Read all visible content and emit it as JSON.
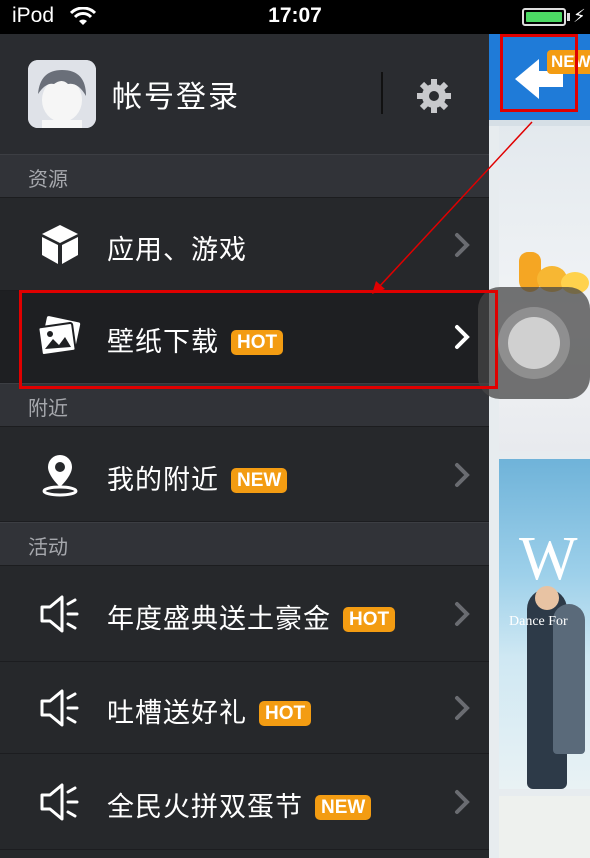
{
  "status_bar": {
    "carrier": "iPod",
    "time": "17:07",
    "battery_level": 1.0
  },
  "drawer": {
    "profile": {
      "login_label": "帐号登录"
    },
    "sections": [
      {
        "title": "资源",
        "items": [
          {
            "label": "应用、游戏",
            "badge": "",
            "icon": "cube-icon"
          },
          {
            "label": "壁纸下载",
            "badge": "HOT",
            "icon": "wallpaper-icon",
            "selected": true
          }
        ]
      },
      {
        "title": "附近",
        "items": [
          {
            "label": "我的附近",
            "badge": "NEW",
            "icon": "location-pin-icon"
          }
        ]
      },
      {
        "title": "活动",
        "items": [
          {
            "label": "年度盛典送土豪金",
            "badge": "HOT",
            "icon": "megaphone-icon"
          },
          {
            "label": "吐槽送好礼",
            "badge": "HOT",
            "icon": "megaphone-icon"
          },
          {
            "label": "全民火拼双蛋节",
            "badge": "NEW",
            "icon": "megaphone-icon"
          }
        ]
      }
    ]
  },
  "preview": {
    "back_badge": "NEW",
    "banner_letter": "W",
    "banner_caption": "Dance For"
  },
  "colors": {
    "drawer_bg": "#26282b",
    "section_bg": "#313338",
    "badge": "#f39c12",
    "accent_blue": "#1f7bd8",
    "annotation_red": "#e00000"
  }
}
